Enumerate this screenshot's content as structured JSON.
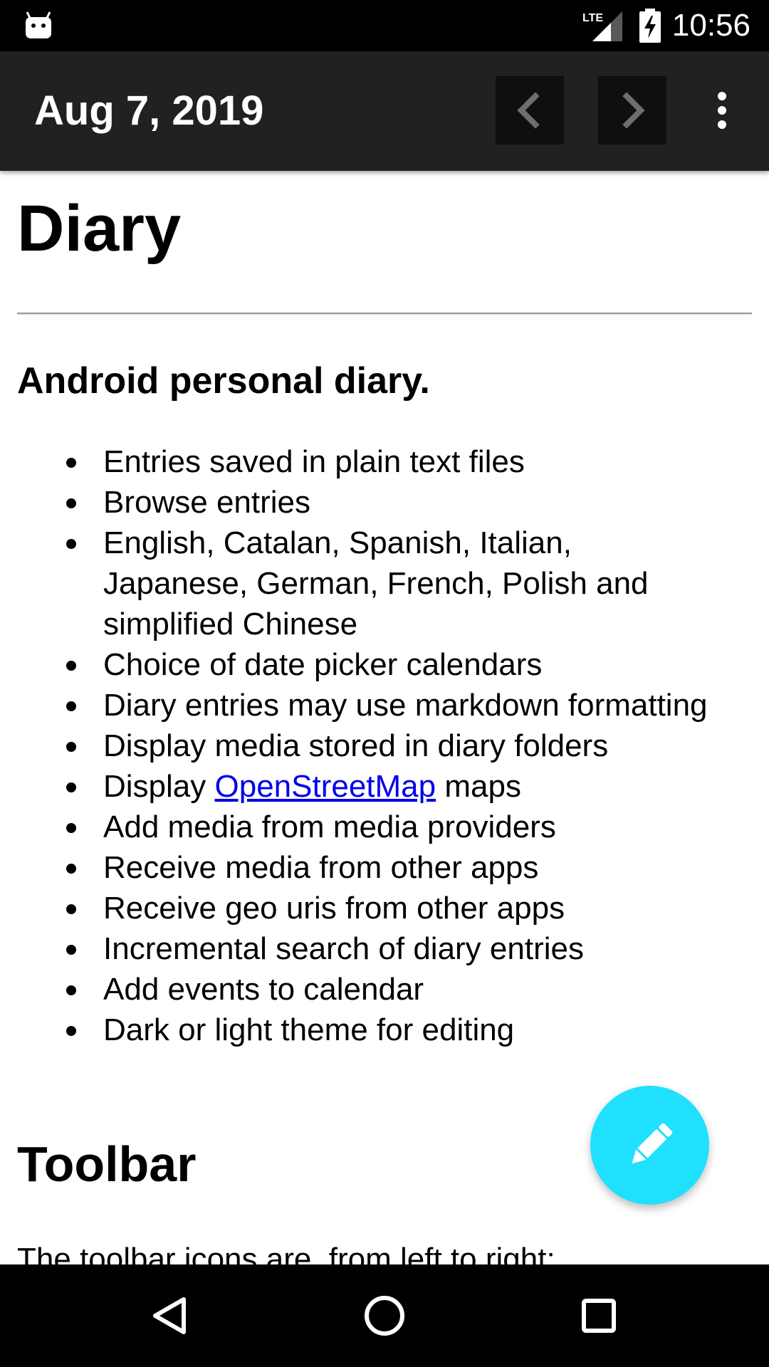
{
  "status_bar": {
    "time": "10:56",
    "network_label": "LTE",
    "icons": [
      "android-debug-icon",
      "lte-signal-icon",
      "battery-charging-icon"
    ]
  },
  "app_bar": {
    "date_title": "Aug 7, 2019",
    "background_color": "#212121",
    "icons": [
      "chevron-left-icon",
      "chevron-right-icon",
      "more-vert-icon"
    ]
  },
  "document": {
    "title": "Diary",
    "subtitle": "Android personal diary.",
    "features": [
      {
        "text": "Entries saved in plain text files"
      },
      {
        "text": "Browse entries"
      },
      {
        "text": "English, Catalan, Spanish, Italian, Japanese, German, French, Polish and simplified Chinese"
      },
      {
        "text": "Choice of date picker calendars"
      },
      {
        "text": "Diary entries may use markdown formatting"
      },
      {
        "text": "Display media stored in diary folders"
      },
      {
        "text_before": "Display ",
        "link_text": "OpenStreetMap",
        "text_after": " maps"
      },
      {
        "text": "Add media from media providers"
      },
      {
        "text": "Receive media from other apps"
      },
      {
        "text": "Receive geo uris from other apps"
      },
      {
        "text": "Incremental search of diary entries"
      },
      {
        "text": "Add events to calendar"
      },
      {
        "text": "Dark or light theme for editing"
      }
    ],
    "section_heading": "Toolbar",
    "section_text": "The toolbar icons are, from left to right:",
    "link_color": "#0000ee"
  },
  "fab": {
    "icon": "pencil-edit-icon",
    "color": "#1fe0ff"
  },
  "navigation_bar": {
    "icons": [
      "back-triangle-icon",
      "home-circle-icon",
      "recents-square-icon"
    ]
  }
}
